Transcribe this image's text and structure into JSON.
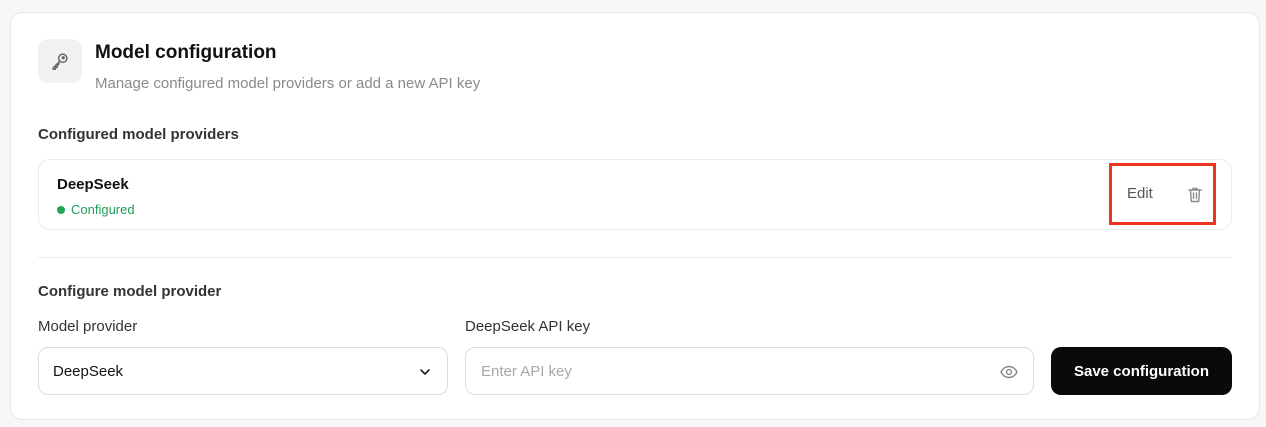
{
  "header": {
    "icon": "key-icon",
    "title": "Model configuration",
    "subtitle": "Manage configured model providers or add a new API key"
  },
  "configured": {
    "section_label": "Configured model providers",
    "providers": [
      {
        "name": "DeepSeek",
        "status": "Configured",
        "status_color": "#22a55a",
        "edit_label": "Edit",
        "delete_icon": "trash-icon"
      }
    ]
  },
  "configure": {
    "section_label": "Configure model provider",
    "provider_field_label": "Model provider",
    "provider_selected": "DeepSeek",
    "api_key_label": "DeepSeek API key",
    "api_key_value": "",
    "api_key_placeholder": "Enter API key",
    "save_label": "Save configuration"
  },
  "colors": {
    "highlight": "#ee3420",
    "primary_button": "#0a0a0a"
  }
}
